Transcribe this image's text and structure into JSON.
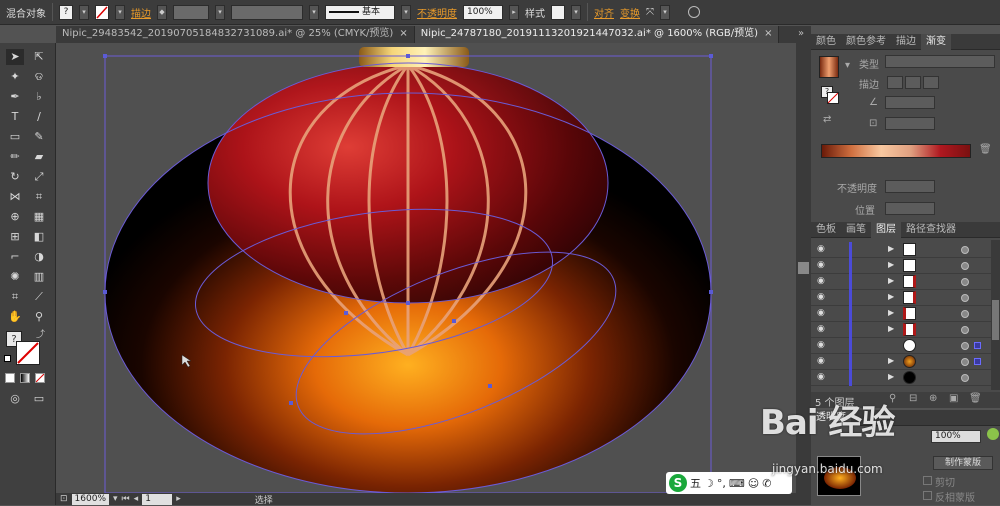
{
  "control_bar": {
    "object_type": "混合对象",
    "stroke_label": "描边",
    "line_style": "基本",
    "opacity_label": "不透明度",
    "opacity_value": "100%",
    "style_label": "样式",
    "align_label": "对齐",
    "transform_label": "变换"
  },
  "tabs": [
    {
      "label": "Nipic_29483542_20190705184832731089.ai* @ 25% (CMYK/预览)"
    },
    {
      "label": "Nipic_24787180_20191113201921447032.ai* @ 1600% (RGB/预览)"
    }
  ],
  "status": {
    "zoom": "1600%",
    "page": "1",
    "tool": "选择"
  },
  "gradient_panel": {
    "tabs": [
      "颜色",
      "颜色参考",
      "描边",
      "渐变"
    ],
    "type_label": "类型",
    "stroke_label": "描边",
    "opacity_label": "不透明度",
    "position_label": "位置"
  },
  "layers_panel": {
    "tabs": [
      "色板",
      "画笔",
      "图层",
      "路径查找器"
    ],
    "count": "5 个图层"
  },
  "transparency_panel": {
    "tab": "透明度",
    "opacity_value": "100%",
    "make_mask": "制作蒙版",
    "clip": "剪切",
    "invert_mask": "反相蒙版"
  },
  "ime": {
    "char": "五"
  },
  "watermark": {
    "text": "Bai 经验",
    "url": "jingyan.baidu.com"
  },
  "colors": {
    "accent": "#e89a2a",
    "selection": "#5b5bd6"
  }
}
